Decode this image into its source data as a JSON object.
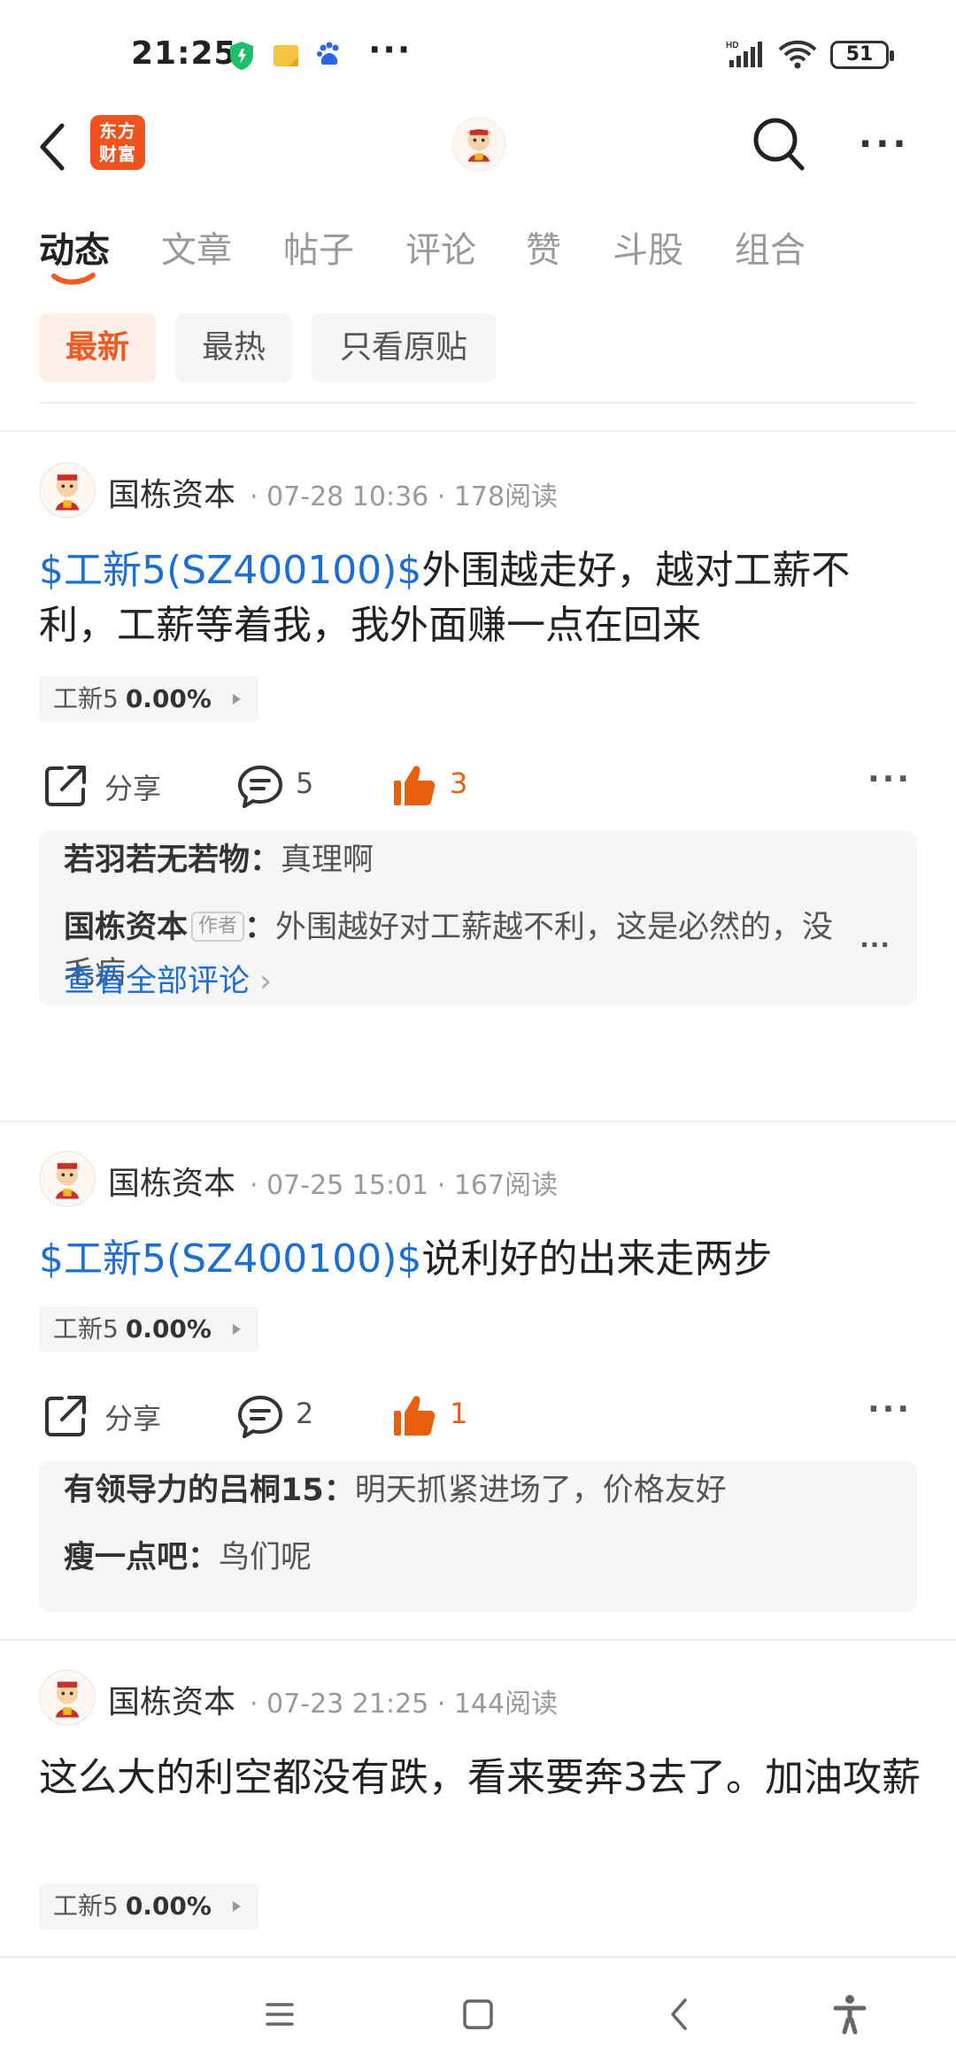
{
  "status_bar": {
    "time": "21:25",
    "battery": "51",
    "icons": [
      "shield-icon",
      "note-icon",
      "baidu-icon",
      "more-icon",
      "signal-icon",
      "wifi-icon",
      "battery-icon"
    ]
  },
  "header": {
    "logo_line1": "东方",
    "logo_line2": "财富"
  },
  "tabs": [
    {
      "label": "动态",
      "active": true
    },
    {
      "label": "文章"
    },
    {
      "label": "帖子"
    },
    {
      "label": "评论"
    },
    {
      "label": "赞"
    },
    {
      "label": "斗股"
    },
    {
      "label": "组合"
    }
  ],
  "filters": [
    {
      "label": "最新",
      "active": true
    },
    {
      "label": "最热"
    },
    {
      "label": "只看原贴"
    }
  ],
  "posts": [
    {
      "author": "国栋资本",
      "meta": "· 07-28 10:36 · 178阅读",
      "stock_link": "$工新5(SZ400100)$",
      "text": "外围越走好，越对工薪不利，工薪等着我，我外面赚一点在回来",
      "tag_name": "工新5",
      "tag_value": "0.00%",
      "share_label": "分享",
      "comment_count": "5",
      "like_count": "3",
      "comments": [
        {
          "who": "若羽若无若物",
          "sep": "：",
          "text": "真理啊"
        },
        {
          "who": "国栋资本",
          "badge": "作者",
          "sep": "：",
          "text": "外围越好对工薪越不利，这是必然的，没毛病"
        }
      ],
      "view_all": "查看全部评论"
    },
    {
      "author": "国栋资本",
      "meta": "· 07-25 15:01 · 167阅读",
      "stock_link": "$工新5(SZ400100)$",
      "text": "说利好的出来走两步",
      "tag_name": "工新5",
      "tag_value": "0.00%",
      "share_label": "分享",
      "comment_count": "2",
      "like_count": "1",
      "comments": [
        {
          "who": "有领导力的吕桐15",
          "sep": "：",
          "text": "明天抓紧进场了，价格友好"
        },
        {
          "who": "瘦一点吧",
          "sep": "：",
          "text": "鸟们呢"
        }
      ]
    },
    {
      "author": "国栋资本",
      "meta": "· 07-23 21:25 · 144阅读",
      "text": "这么大的利空都没有跌，看来要奔3去了。加油攻薪",
      "tag_name": "工新5",
      "tag_value": "0.00%"
    }
  ],
  "colors": {
    "accent": "#f05a24",
    "link": "#1c6fd1",
    "like": "#e8600e"
  }
}
